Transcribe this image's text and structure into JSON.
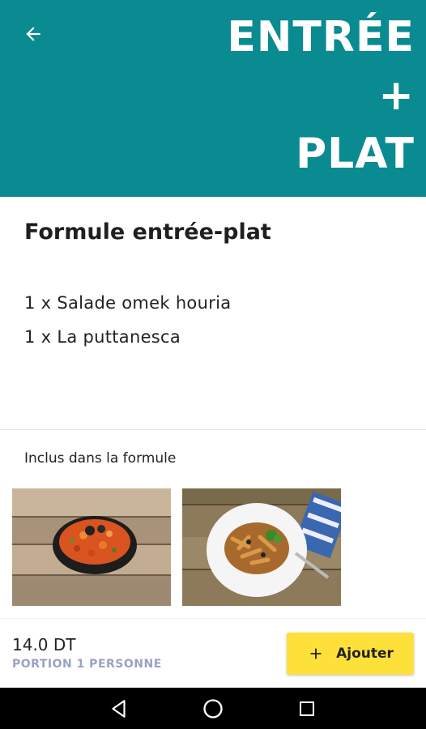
{
  "header": {
    "banner_lines": [
      "ENTRÉE",
      "+",
      "PLAT"
    ],
    "color": "#0a8a91",
    "back_icon": "arrow-left-icon"
  },
  "main": {
    "title": "Formule entrée-plat",
    "items": [
      "1 x Salade omek houria",
      "1 x La puttanesca"
    ],
    "included_label": "Inclus dans la formule"
  },
  "footer": {
    "price": "14.0 DT",
    "portion": "PORTION 1 PERSONNE",
    "add_button": "Ajouter",
    "add_icon": "plus-icon",
    "button_color": "#fde13a"
  },
  "navbar": {
    "icons": [
      "back-triangle-icon",
      "home-circle-icon",
      "recents-square-icon"
    ]
  }
}
